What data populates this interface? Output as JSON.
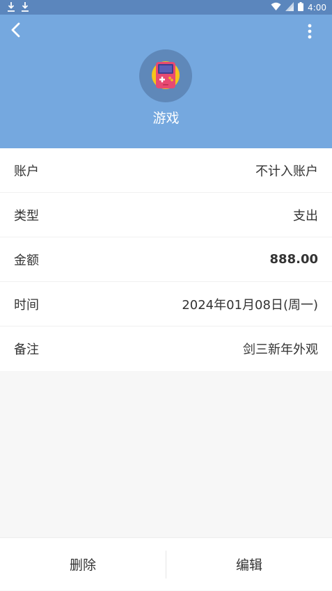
{
  "status_bar": {
    "time": "4:00"
  },
  "header": {
    "category_name": "游戏",
    "back_icon": "chevron-left-icon",
    "more_icon": "more-vertical-icon",
    "category_icon": "game-console-icon",
    "background_color": "#75a8df"
  },
  "details": {
    "rows": [
      {
        "label": "账户",
        "value": "不计入账户"
      },
      {
        "label": "类型",
        "value": "支出"
      },
      {
        "label": "金额",
        "value": "888.00"
      },
      {
        "label": "时间",
        "value": "2024年01月08日(周一)"
      },
      {
        "label": "备注",
        "value": "剑三新年外观"
      }
    ]
  },
  "actions": {
    "delete_label": "删除",
    "edit_label": "编辑"
  }
}
